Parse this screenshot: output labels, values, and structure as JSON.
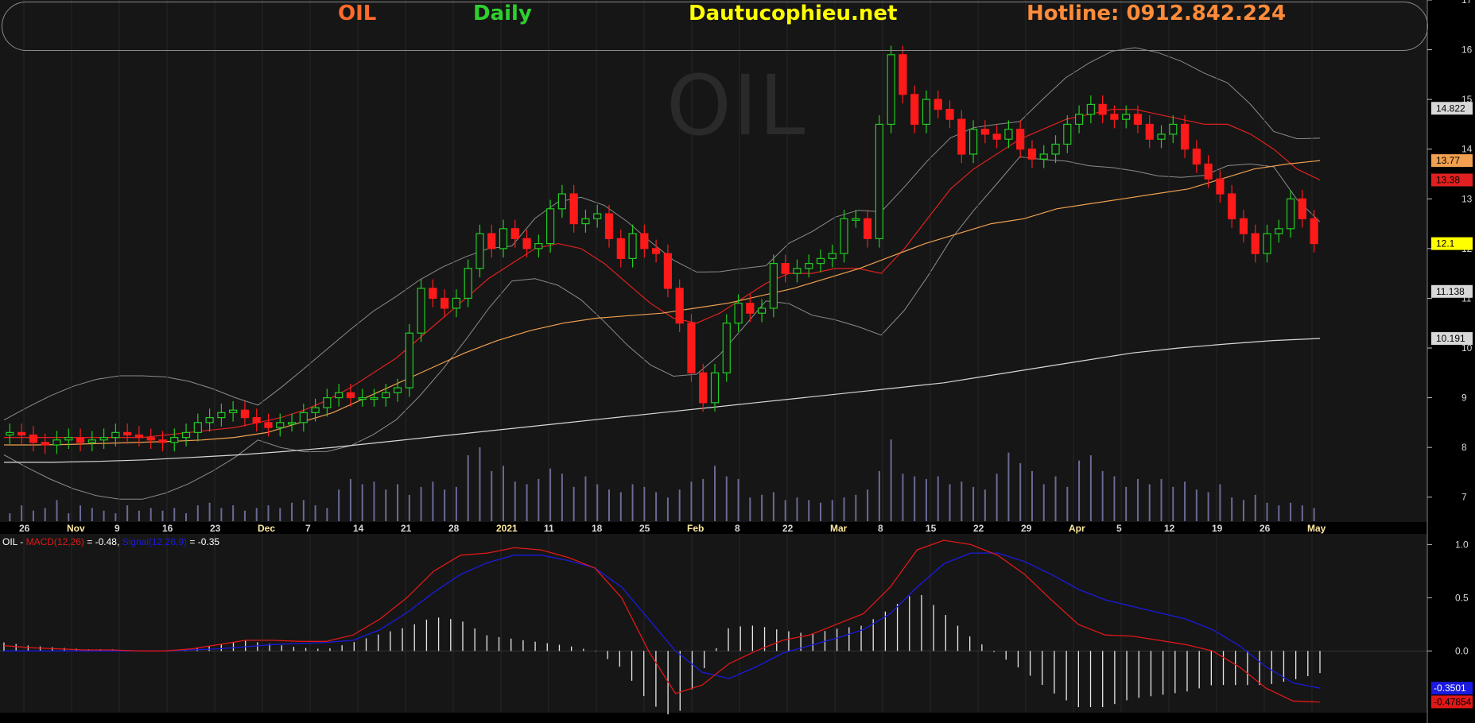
{
  "header": {
    "symbol": "OIL",
    "timeframe": "Daily",
    "site": "Dautucophieu.net",
    "hotline": "Hotline: 0912.842.224"
  },
  "watermark": "OIL",
  "colors": {
    "symbol": "#ff6a2a",
    "timeframe": "#2fcf2f",
    "site": "#ffff00",
    "hotline": "#ff8c3a",
    "up_candle": "#22cc22",
    "down_candle": "#ff1a1a",
    "ma_red": "#e02020",
    "ma_orange": "#f0a050",
    "ma_white": "#d8d8d8",
    "bollinger": "#8c8c8c",
    "volume": "#6a6a96",
    "macd_line": "#e01818",
    "signal_line": "#1a1ae0",
    "histogram": "#e8e8e8"
  },
  "macd_legend": {
    "prefix": "OIL - ",
    "macd_name": "MACD(12,26)",
    "macd_value": " = -0.48, ",
    "signal_name": "Signal(12,26,9)",
    "signal_value": " = -0.35"
  },
  "chart_data": [
    {
      "type": "candlestick",
      "title": "OIL Daily",
      "x_tick_labels": [
        "26",
        "Nov",
        "9",
        "16",
        "23",
        "Dec",
        "7",
        "14",
        "21",
        "28",
        "2021",
        "11",
        "18",
        "25",
        "Feb",
        "8",
        "22",
        "Mar",
        "8",
        "15",
        "22",
        "29",
        "Apr",
        "5",
        "12",
        "19",
        "26",
        "May"
      ],
      "ylim": [
        6.5,
        17
      ],
      "y_ticks": [
        7,
        8,
        9,
        10,
        11,
        12,
        13,
        14,
        15,
        16,
        17
      ],
      "ohlc_close": [
        8.3,
        8.25,
        8.1,
        8.05,
        8.15,
        8.2,
        8.1,
        8.15,
        8.2,
        8.3,
        8.25,
        8.2,
        8.15,
        8.1,
        8.2,
        8.3,
        8.5,
        8.6,
        8.7,
        8.75,
        8.6,
        8.5,
        8.4,
        8.5,
        8.5,
        8.7,
        8.8,
        9.0,
        9.1,
        9.0,
        9.0,
        9.0,
        9.1,
        9.2,
        10.3,
        11.2,
        11.0,
        10.8,
        11.0,
        11.6,
        12.3,
        12.0,
        12.4,
        12.2,
        12.0,
        12.1,
        12.8,
        13.1,
        12.5,
        12.6,
        12.7,
        12.2,
        11.8,
        12.3,
        12.0,
        11.9,
        11.2,
        10.5,
        9.5,
        8.9,
        9.5,
        10.5,
        10.9,
        10.7,
        10.8,
        11.7,
        11.5,
        11.6,
        11.7,
        11.8,
        11.9,
        12.6,
        12.6,
        12.2,
        14.5,
        15.9,
        15.1,
        14.5,
        15.0,
        14.8,
        14.6,
        13.9,
        14.4,
        14.3,
        14.2,
        14.4,
        14.0,
        13.8,
        13.9,
        14.1,
        14.5,
        14.7,
        14.9,
        14.7,
        14.6,
        14.7,
        14.5,
        14.2,
        14.3,
        14.5,
        14.0,
        13.7,
        13.4,
        13.1,
        12.6,
        12.3,
        11.9,
        12.3,
        12.4,
        13.0,
        12.6,
        12.1
      ],
      "recent_price_labels": {
        "bb_upper": 14.822,
        "ma_orange": 13.77,
        "ma_red": 13.38,
        "close": 12.1,
        "bb_lower": 11.138,
        "ma_white": 10.191
      },
      "series": [
        {
          "name": "",
          "values": [
            8.2,
            8.2,
            8.2,
            8.2,
            8.2,
            8.2,
            8.2,
            8.25,
            8.3,
            8.35,
            8.4,
            8.5,
            8.6,
            8.75,
            8.95,
            9.2,
            9.5,
            9.8,
            10.2,
            10.6,
            11.0,
            11.4,
            11.7,
            12.0,
            12.1,
            12.0,
            11.7,
            11.3,
            10.9,
            10.6,
            10.5,
            10.7,
            11.0,
            11.3,
            11.5,
            11.5,
            11.6,
            11.6,
            11.5,
            12.0,
            12.6,
            13.2,
            13.6,
            13.9,
            14.2,
            14.4,
            14.6,
            14.7,
            14.8,
            14.8,
            14.7,
            14.6,
            14.5,
            14.5,
            14.3,
            14.0,
            13.6,
            13.38
          ]
        },
        {
          "name": "",
          "values": [
            8.05,
            8.05,
            8.06,
            8.08,
            8.1,
            8.12,
            8.15,
            8.2,
            8.3,
            8.5,
            8.7,
            9.0,
            9.3,
            9.6,
            9.9,
            10.15,
            10.35,
            10.5,
            10.6,
            10.65,
            10.7,
            10.8,
            10.9,
            11.05,
            11.2,
            11.4,
            11.6,
            11.85,
            12.1,
            12.3,
            12.5,
            12.6,
            12.8,
            12.9,
            13.0,
            13.1,
            13.2,
            13.4,
            13.6,
            13.7,
            13.77
          ]
        },
        {
          "name": "",
          "values": [
            7.7,
            7.7,
            7.72,
            7.75,
            7.8,
            7.85,
            7.92,
            8.0,
            8.1,
            8.2,
            8.3,
            8.4,
            8.5,
            8.6,
            8.7,
            8.8,
            8.9,
            9.0,
            9.1,
            9.2,
            9.3,
            9.45,
            9.6,
            9.75,
            9.9,
            10.0,
            10.08,
            10.15,
            10.191
          ]
        }
      ]
    },
    {
      "type": "bar",
      "title": "Volume",
      "values": [
        0.3,
        0.6,
        0.4,
        0.5,
        0.8,
        0.3,
        0.6,
        0.5,
        0.4,
        0.3,
        0.6,
        0.4,
        0.5,
        0.4,
        0.5,
        0.3,
        0.6,
        0.7,
        0.5,
        0.6,
        0.4,
        0.5,
        0.6,
        0.5,
        0.7,
        0.8,
        0.6,
        0.5,
        1.2,
        1.6,
        1.4,
        1.5,
        1.2,
        1.4,
        1.0,
        1.3,
        1.5,
        1.2,
        1.3,
        2.5,
        2.8,
        1.9,
        2.1,
        1.5,
        1.4,
        1.6,
        2.0,
        1.8,
        1.3,
        1.7,
        1.4,
        1.2,
        1.1,
        1.4,
        1.3,
        1.1,
        0.9,
        1.2,
        1.5,
        1.6,
        2.1,
        1.7,
        1.6,
        0.9,
        1.0,
        1.1,
        0.8,
        0.9,
        0.8,
        0.7,
        0.8,
        0.9,
        1.0,
        1.2,
        1.9,
        3.1,
        1.8,
        1.7,
        1.6,
        1.7,
        1.4,
        1.5,
        1.3,
        1.2,
        1.8,
        2.6,
        2.2,
        1.9,
        1.4,
        1.7,
        1.3,
        2.3,
        2.5,
        1.9,
        1.7,
        1.3,
        1.6,
        1.4,
        1.6,
        1.3,
        1.5,
        1.2,
        1.1,
        1.4,
        0.9,
        0.8,
        1.0,
        0.7,
        0.6,
        0.7,
        0.6,
        0.5
      ],
      "ylim": [
        0,
        5
      ]
    },
    {
      "type": "line",
      "title": "MACD(12,26) / Signal(12,26,9)",
      "ylim": [
        -0.58,
        1.1
      ],
      "y_ticks": [
        0.0,
        0.5,
        1.0
      ],
      "last_values": {
        "signal": -0.3501,
        "macd": -0.47854
      },
      "series": [
        {
          "name": "MACD(12,26)",
          "values": [
            0.05,
            0.03,
            0.02,
            0.01,
            0.01,
            0.0,
            0.0,
            0.02,
            0.06,
            0.1,
            0.1,
            0.09,
            0.09,
            0.15,
            0.3,
            0.5,
            0.75,
            0.9,
            0.92,
            0.97,
            0.95,
            0.88,
            0.78,
            0.5,
            0.0,
            -0.4,
            -0.32,
            -0.12,
            0.0,
            0.1,
            0.15,
            0.25,
            0.35,
            0.6,
            0.95,
            1.04,
            1.0,
            0.9,
            0.72,
            0.48,
            0.25,
            0.15,
            0.14,
            0.1,
            0.06,
            0.0,
            -0.15,
            -0.35,
            -0.47,
            -0.48
          ]
        },
        {
          "name": "Signal(12,26,9)",
          "values": [
            0.0,
            0.0,
            0.0,
            0.0,
            0.0,
            0.0,
            0.0,
            0.01,
            0.02,
            0.04,
            0.06,
            0.07,
            0.08,
            0.1,
            0.2,
            0.36,
            0.55,
            0.72,
            0.83,
            0.9,
            0.9,
            0.85,
            0.78,
            0.6,
            0.3,
            0.0,
            -0.2,
            -0.26,
            -0.15,
            -0.02,
            0.05,
            0.12,
            0.2,
            0.35,
            0.6,
            0.82,
            0.92,
            0.92,
            0.84,
            0.72,
            0.58,
            0.48,
            0.42,
            0.36,
            0.3,
            0.2,
            0.05,
            -0.15,
            -0.3,
            -0.35
          ]
        }
      ]
    }
  ]
}
